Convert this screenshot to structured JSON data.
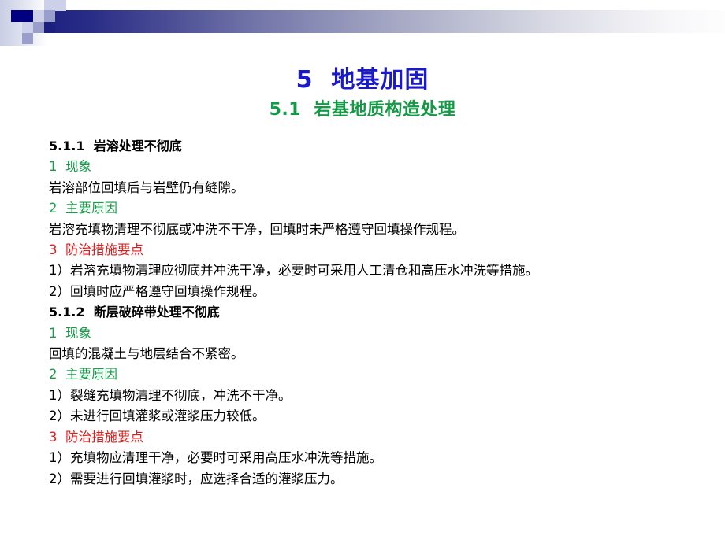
{
  "slide": {
    "title": "5  地基加固",
    "subtitle": "5.1  岩基地质构造处理",
    "title_color": "#1a1acc",
    "subtitle_color": "#149a46"
  },
  "decoration": {
    "name": "header-mosaic-gradient-bar",
    "navy_color": "#000080",
    "deep_blue_color": "#1b1f7d",
    "pale_blue_color": "#ccd0e8",
    "mid_blue_color": "#9a9ecb",
    "bar_gradient_from": "#1d2080",
    "bar_gradient_to": "#fdfdfe"
  },
  "body": {
    "lines": [
      {
        "text": "5.1.1  岩溶处理不彻底",
        "style": "heading"
      },
      {
        "text": "1  现象",
        "style": "green"
      },
      {
        "text": "岩溶部位回填后与岩壁仍有缝隙。",
        "style": "plain"
      },
      {
        "text": "2  主要原因",
        "style": "green"
      },
      {
        "text": "岩溶充填物清理不彻底或冲洗不干净，回填时未严格遵守回填操作规程。",
        "style": "plain"
      },
      {
        "text": "3  防治措施要点",
        "style": "red"
      },
      {
        "text": "1）岩溶充填物清理应彻底并冲洗干净，必要时可采用人工清仓和高压水冲洗等措施。",
        "style": "plain"
      },
      {
        "text": "2）回填时应严格遵守回填操作规程。",
        "style": "plain"
      },
      {
        "text": "5.1.2  断层破碎带处理不彻底",
        "style": "heading"
      },
      {
        "text": "1  现象",
        "style": "green"
      },
      {
        "text": "回填的混凝土与地层结合不紧密。",
        "style": "plain"
      },
      {
        "text": "2  主要原因",
        "style": "green"
      },
      {
        "text": "1）裂缝充填物清理不彻底，冲洗不干净。",
        "style": "plain"
      },
      {
        "text": "2）未进行回填灌浆或灌浆压力较低。",
        "style": "plain"
      },
      {
        "text": "3  防治措施要点",
        "style": "red"
      },
      {
        "text": "1）充填物应清理干净，必要时可采用高压水冲洗等措施。",
        "style": "plain"
      },
      {
        "text": "2）需要进行回填灌浆时，应选择合适的灌浆压力。",
        "style": "plain"
      }
    ]
  }
}
